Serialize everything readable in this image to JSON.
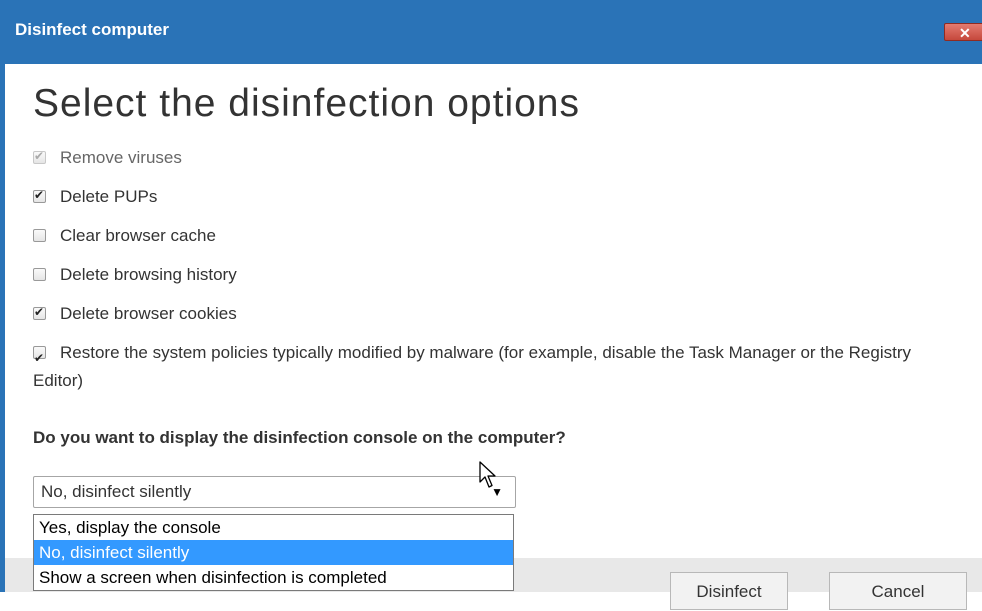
{
  "window": {
    "title": "Disinfect computer",
    "close_glyph": "✕"
  },
  "heading": "Select the disinfection options",
  "options": [
    {
      "label": "Remove viruses",
      "checked": true,
      "disabled": true
    },
    {
      "label": "Delete PUPs",
      "checked": true,
      "disabled": false
    },
    {
      "label": "Clear browser cache",
      "checked": false,
      "disabled": false
    },
    {
      "label": "Delete browsing history",
      "checked": false,
      "disabled": false
    },
    {
      "label": "Delete browser cookies",
      "checked": true,
      "disabled": false
    },
    {
      "label": "Restore the system policies typically modified by malware (for example, disable the Task Manager or the Registry Editor)",
      "checked": true,
      "disabled": false
    }
  ],
  "question": "Do you want to display the disinfection console on the computer?",
  "console_select": {
    "value": "No, disinfect silently",
    "options": [
      "Yes, display the console",
      "No, disinfect silently",
      "Show a screen when disinfection is completed"
    ],
    "highlighted_index": 1
  },
  "buttons": {
    "disinfect": "Disinfect",
    "cancel": "Cancel"
  },
  "icons": {
    "close": "close-icon",
    "dropdown_arrow": "chevron-down-icon",
    "cursor": "mouse-pointer-icon"
  },
  "colors": {
    "titlebar": "#2a73b7",
    "selection": "#3399ff",
    "footer": "#e8e8e8"
  }
}
